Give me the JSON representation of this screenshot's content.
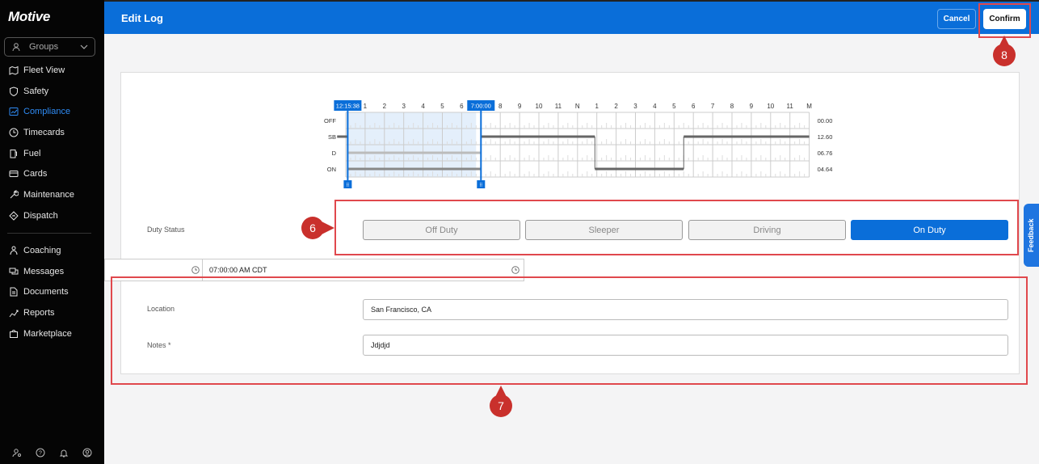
{
  "sidebar": {
    "logo": "Motive",
    "groups_label": "Groups",
    "items": [
      {
        "label": "Fleet View",
        "icon": "map-icon"
      },
      {
        "label": "Safety",
        "icon": "shield-icon"
      },
      {
        "label": "Compliance",
        "icon": "chart-icon"
      },
      {
        "label": "Timecards",
        "icon": "clock-icon"
      },
      {
        "label": "Fuel",
        "icon": "fuel-icon"
      },
      {
        "label": "Cards",
        "icon": "card-icon"
      },
      {
        "label": "Maintenance",
        "icon": "wrench-icon"
      },
      {
        "label": "Dispatch",
        "icon": "dispatch-icon"
      }
    ],
    "items2": [
      {
        "label": "Coaching",
        "icon": "coaching-icon"
      },
      {
        "label": "Messages",
        "icon": "messages-icon"
      },
      {
        "label": "Documents",
        "icon": "document-icon"
      },
      {
        "label": "Reports",
        "icon": "reports-icon"
      },
      {
        "label": "Marketplace",
        "icon": "marketplace-icon"
      }
    ],
    "active": "Compliance"
  },
  "header": {
    "title": "Edit Log",
    "cancel_label": "Cancel",
    "confirm_label": "Confirm"
  },
  "log_chart": {
    "start_time_tag": "12:15:38",
    "end_time_tag": "7:00:00",
    "hour_labels": [
      "1",
      "2",
      "3",
      "4",
      "5",
      "6",
      "7",
      "8",
      "9",
      "10",
      "11",
      "N",
      "1",
      "2",
      "3",
      "4",
      "5",
      "6",
      "7",
      "8",
      "9",
      "10",
      "11",
      "M"
    ],
    "rows": [
      "OFF",
      "SB",
      "D",
      "ON"
    ],
    "totals": [
      "00.00",
      "12.60",
      "06.76",
      "04.64"
    ]
  },
  "duty_status": {
    "label": "Duty Status",
    "options": [
      "Off Duty",
      "Sleeper",
      "Driving",
      "On Duty"
    ],
    "selected": "On Duty"
  },
  "time_field": {
    "value": "07:00:00 AM CDT"
  },
  "location": {
    "label": "Location",
    "value": "San Francisco, CA"
  },
  "notes": {
    "label": "Notes *",
    "value": "Jdjdjd"
  },
  "markers": {
    "m6": "6",
    "m7": "7",
    "m8": "8"
  },
  "feedback_label": "Feedback",
  "colors": {
    "brand_blue": "#0a6ed9",
    "sidebar_bg": "#050505",
    "annotation_red": "#e0484d"
  }
}
